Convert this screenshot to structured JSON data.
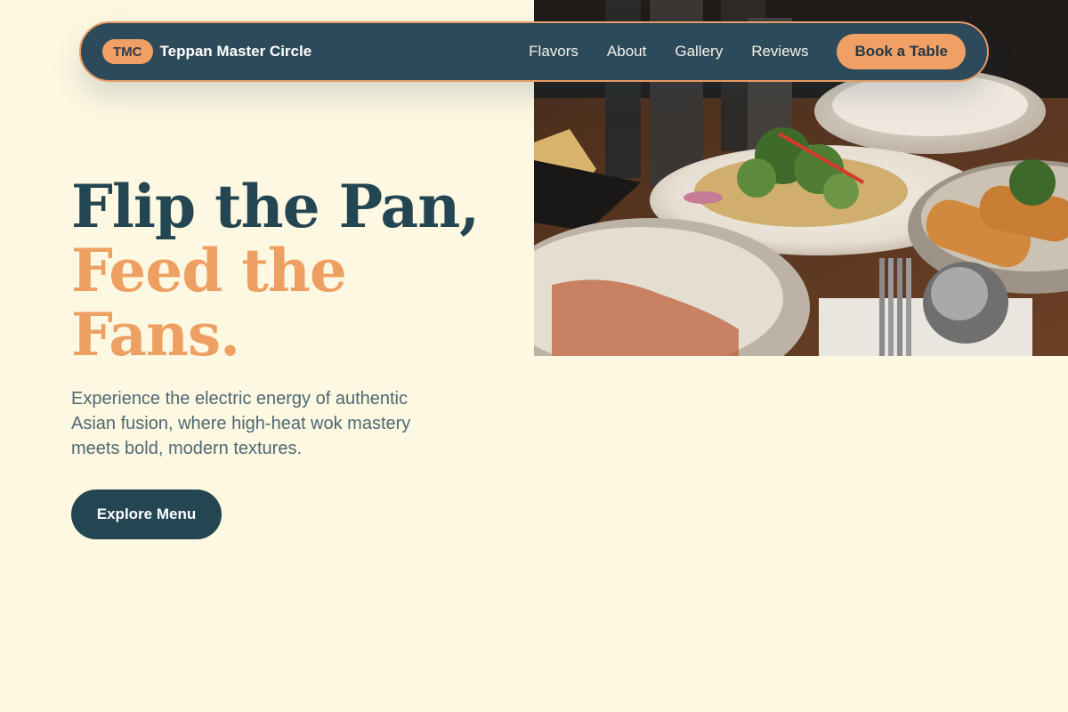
{
  "colors": {
    "background": "#fdf8e1",
    "navy": "#244552",
    "accent": "#ee9f62",
    "nav_bg": "#2d4a5a"
  },
  "nav": {
    "brand_badge": "TMC",
    "brand_name": "Teppan Master Circle",
    "links": [
      "Flavors",
      "About",
      "Gallery",
      "Reviews"
    ],
    "cta": "Book a Table"
  },
  "hero": {
    "title_line1": "Flip the Pan,",
    "title_line2": "Feed the Fans.",
    "subtitle": "Experience the electric energy of authentic Asian fusion, where high-heat wok mastery meets bold, modern textures.",
    "cta": "Explore Menu",
    "image_icon": "food-photo"
  }
}
